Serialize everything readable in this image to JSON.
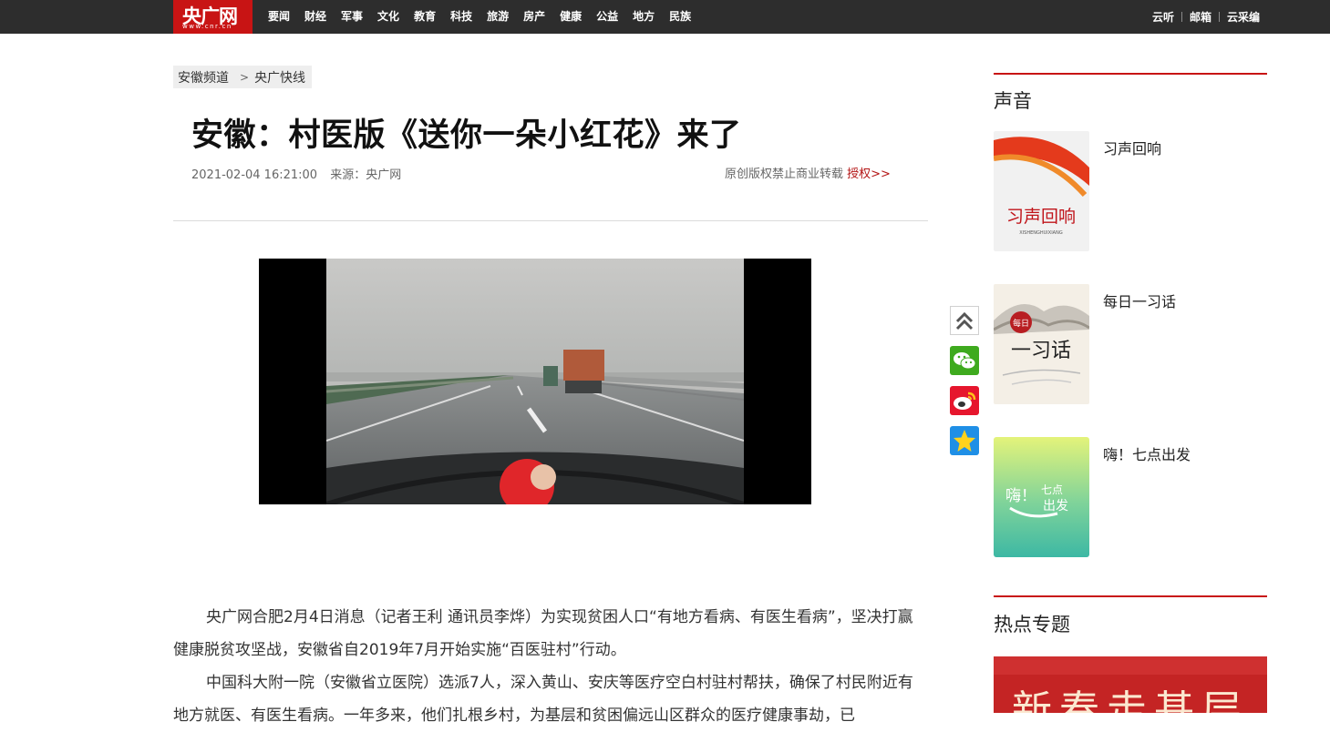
{
  "header": {
    "logo_cn": "央广网",
    "logo_en": "www.cnr.cn",
    "nav": [
      "要闻",
      "财经",
      "军事",
      "文化",
      "教育",
      "科技",
      "旅游",
      "房产",
      "健康",
      "公益",
      "地方",
      "民族"
    ],
    "links": [
      "云听",
      "邮箱",
      "云采编"
    ]
  },
  "breadcrumb": {
    "channel": "安徽频道",
    "arrow": ">",
    "section": "央广快线"
  },
  "article": {
    "title": "安徽：村医版《送你一朵小红花》来了",
    "datetime": "2021-02-04 16:21:00",
    "source": "来源：央广网",
    "copyright": "原创版权禁止商业转载",
    "auth_link": "授权>>",
    "paragraphs": [
      "央广网合肥2月4日消息（记者王利 通讯员李烨）为实现贫困人口“有地方看病、有医生看病”，坚决打赢健康脱贫攻坚战，安徽省自2019年7月开始实施“百医驻村”行动。",
      "中国科大附一院（安徽省立医院）选派7人，深入黄山、安庆等医疗空白村驻村帮扶，确保了村民附近有地方就医、有医生看病。一年多来，他们扎根乡村，为基层和贫困偏远山区群众的医疗健康事劫，已"
    ]
  },
  "sidebar": {
    "voice_title": "声音",
    "voice_items": [
      {
        "label": "习声回响",
        "thumb_text": "习声回响",
        "thumb_sub": "XISHENGHUIXIANG"
      },
      {
        "label": "每日一习话",
        "thumb_text": "一习话",
        "thumb_seal": "每日"
      },
      {
        "label": "嗨！七点出发",
        "thumb_text": "嗨！",
        "thumb_text2": "七点",
        "thumb_text3": "出发"
      }
    ],
    "hot_title": "热点专题",
    "banner_text": "新春走基层"
  },
  "colors": {
    "brand_red": "#c81414",
    "topbar_bg": "#2d2d2d",
    "auth_link": "#b31414"
  },
  "icons": [
    "back-to-top-icon",
    "wechat-icon",
    "weibo-icon",
    "qzone-icon"
  ]
}
